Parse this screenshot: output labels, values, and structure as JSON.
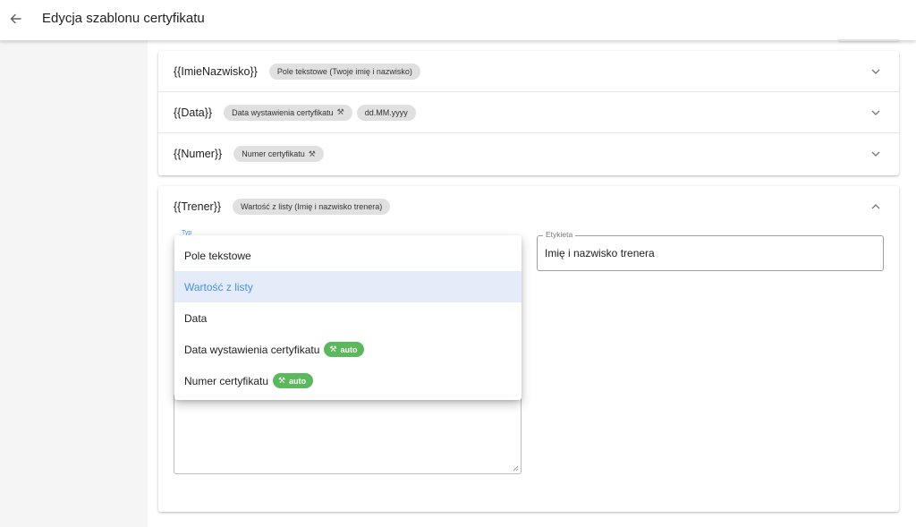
{
  "header": {
    "title": "Edycja szablonu certyfikatu"
  },
  "fields": [
    {
      "key": "{{ImieNazwisko}}",
      "chips": [
        "Pole tekstowe (Twoje imię i nazwisko)"
      ]
    },
    {
      "key": "{{Data}}",
      "chips": [
        "Data wystawienia certyfikatu",
        "dd.MM.yyyy"
      ]
    },
    {
      "key": "{{Numer}}",
      "chips": [
        "Numer certyfikatu"
      ]
    }
  ],
  "expanded": {
    "key": "{{Trener}}",
    "chip": "Wartość z listy (Imię i nazwisko trenera)",
    "typ_label": "Typ",
    "etykieta_label": "Etykieta",
    "etykieta_value": "Imię i nazwisko trenera"
  },
  "dropdown": {
    "options": [
      {
        "label": "Pole tekstowe"
      },
      {
        "label": "Wartość z listy",
        "selected": true
      },
      {
        "label": "Data"
      },
      {
        "label": "Data wystawienia certyfikatu",
        "badge": "auto"
      },
      {
        "label": "Numer certyfikatu",
        "badge": "auto"
      }
    ]
  },
  "icons": {
    "back": "arrow-left-icon",
    "expand": "chevron-down-icon",
    "collapse": "chevron-up-icon",
    "auto": "magic-wand-icon"
  },
  "colors": {
    "accent": "#4a90e2",
    "selected_bg": "#e3ecf8",
    "auto_badge": "#5cb85c",
    "chip_bg": "#e0e0e0"
  }
}
